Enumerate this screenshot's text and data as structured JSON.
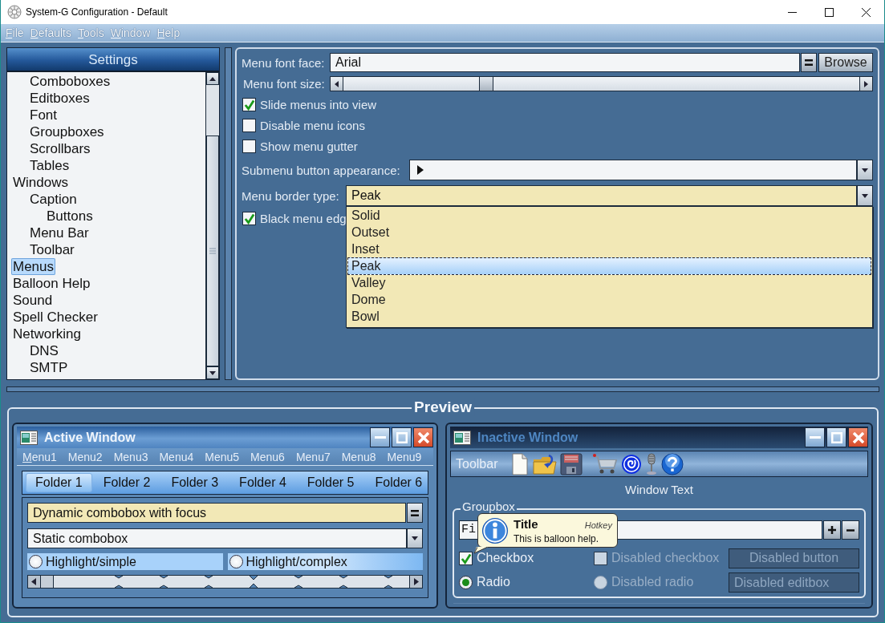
{
  "window": {
    "title": "System-G Configuration - Default"
  },
  "menu_bar": [
    {
      "label": "File"
    },
    {
      "label": "Defaults"
    },
    {
      "label": "Tools"
    },
    {
      "label": "Window"
    },
    {
      "label": "Help"
    }
  ],
  "settings": {
    "title": "Settings",
    "tree": [
      {
        "children": [
          {
            "label": "Comboboxes",
            "selected": false
          },
          {
            "label": "Editboxes",
            "selected": false
          },
          {
            "label": "Font",
            "selected": false
          },
          {
            "label": "Groupboxes",
            "selected": false
          },
          {
            "label": "Scrollbars",
            "selected": false
          },
          {
            "label": "Tables",
            "selected": false
          }
        ]
      },
      {
        "label": "Windows",
        "selected": false,
        "children": [
          {
            "label": "Caption",
            "selected": false,
            "children": [
              {
                "label": "Buttons",
                "selected": false
              }
            ]
          },
          {
            "label": "Menu Bar",
            "selected": false
          },
          {
            "label": "Toolbar",
            "selected": false
          }
        ]
      },
      {
        "label": "Menus",
        "selected": true
      },
      {
        "label": "Balloon Help",
        "selected": false
      },
      {
        "label": "Sound",
        "selected": false
      },
      {
        "label": "Spell Checker",
        "selected": false
      },
      {
        "label": "Networking",
        "selected": false,
        "children": [
          {
            "label": "DNS",
            "selected": false
          },
          {
            "label": "SMTP",
            "selected": false
          }
        ]
      }
    ]
  },
  "menu_settings": {
    "font_face": {
      "label": "Menu font face:",
      "value": "Arial",
      "browse": "Browse"
    },
    "font_size": {
      "label": "Menu font size:",
      "level": 0.27
    },
    "checkboxes": [
      {
        "label": "Slide menus into view",
        "checked": true
      },
      {
        "label": "Disable menu icons",
        "checked": false
      },
      {
        "label": "Show menu gutter",
        "checked": false
      }
    ],
    "submenu_button": {
      "label": "Submenu button appearance:"
    },
    "border_type": {
      "label": "Menu border type:",
      "value": "Peak",
      "expanded": true,
      "options": [
        {
          "label": "Solid",
          "selected": false
        },
        {
          "label": "Outset",
          "selected": false
        },
        {
          "label": "Inset",
          "selected": false
        },
        {
          "label": "Peak",
          "selected": true
        },
        {
          "label": "Valley",
          "selected": false
        },
        {
          "label": "Dome",
          "selected": false
        },
        {
          "label": "Bowl",
          "selected": false
        }
      ]
    },
    "black_edge": {
      "label": "Black menu edg",
      "checked": true
    }
  },
  "preview": {
    "title": "Preview",
    "windows": [
      {
        "kind": "tabbed",
        "active": true,
        "title": "Active Window",
        "menus": [
          {
            "label": "Menu1",
            "mnemonic": true
          },
          {
            "label": "Menu2",
            "mnemonic": false
          },
          {
            "label": "Menu3",
            "mnemonic": false
          },
          {
            "label": "Menu4",
            "mnemonic": false
          },
          {
            "label": "Menu5",
            "mnemonic": false
          },
          {
            "label": "Menu6",
            "mnemonic": false
          },
          {
            "label": "Menu7",
            "mnemonic": false
          },
          {
            "label": "Menu8",
            "mnemonic": false
          },
          {
            "label": "Menu9",
            "mnemonic": false
          }
        ],
        "tabs": [
          {
            "label": "Folder 1",
            "selected": true
          },
          {
            "label": "Folder 2",
            "selected": false
          },
          {
            "label": "Folder 3",
            "selected": false
          },
          {
            "label": "Folder 4",
            "selected": false
          },
          {
            "label": "Folder 5",
            "selected": false
          },
          {
            "label": "Folder 6",
            "selected": false
          }
        ],
        "dynamic_combo": {
          "value": "Dynamic combobox with focus"
        },
        "static_combo": {
          "value": "Static combobox"
        },
        "radios": [
          {
            "label": "Highlight/simple",
            "kind": "simple",
            "selected": false
          },
          {
            "label": "Highlight/complex",
            "kind": "complex",
            "selected": false
          }
        ]
      },
      {
        "kind": "toolbar",
        "active": false,
        "title": "Inactive Window",
        "toolbar": {
          "label": "Toolbar"
        },
        "window_text": "Window Text",
        "groupbox": {
          "title": "Groupbox",
          "edit_value": "Fi",
          "controls": [
            {
              "kind": "checkbox",
              "label": "Checkbox",
              "checked": true,
              "disabled": false
            },
            {
              "kind": "checkbox",
              "label": "Disabled checkbox",
              "checked": false,
              "disabled": true
            },
            {
              "kind": "button",
              "label": "Disabled button",
              "disabled": true
            },
            {
              "kind": "radio",
              "label": "Radio",
              "selected": true,
              "disabled": false
            },
            {
              "kind": "radio",
              "label": "Disabled radio",
              "selected": false,
              "disabled": true
            },
            {
              "kind": "editbox",
              "value": "Disabled editbox",
              "disabled": true
            }
          ]
        },
        "balloon": {
          "title": "Title",
          "hotkey": "Hotkey",
          "text": "This is balloon help."
        }
      }
    ]
  }
}
